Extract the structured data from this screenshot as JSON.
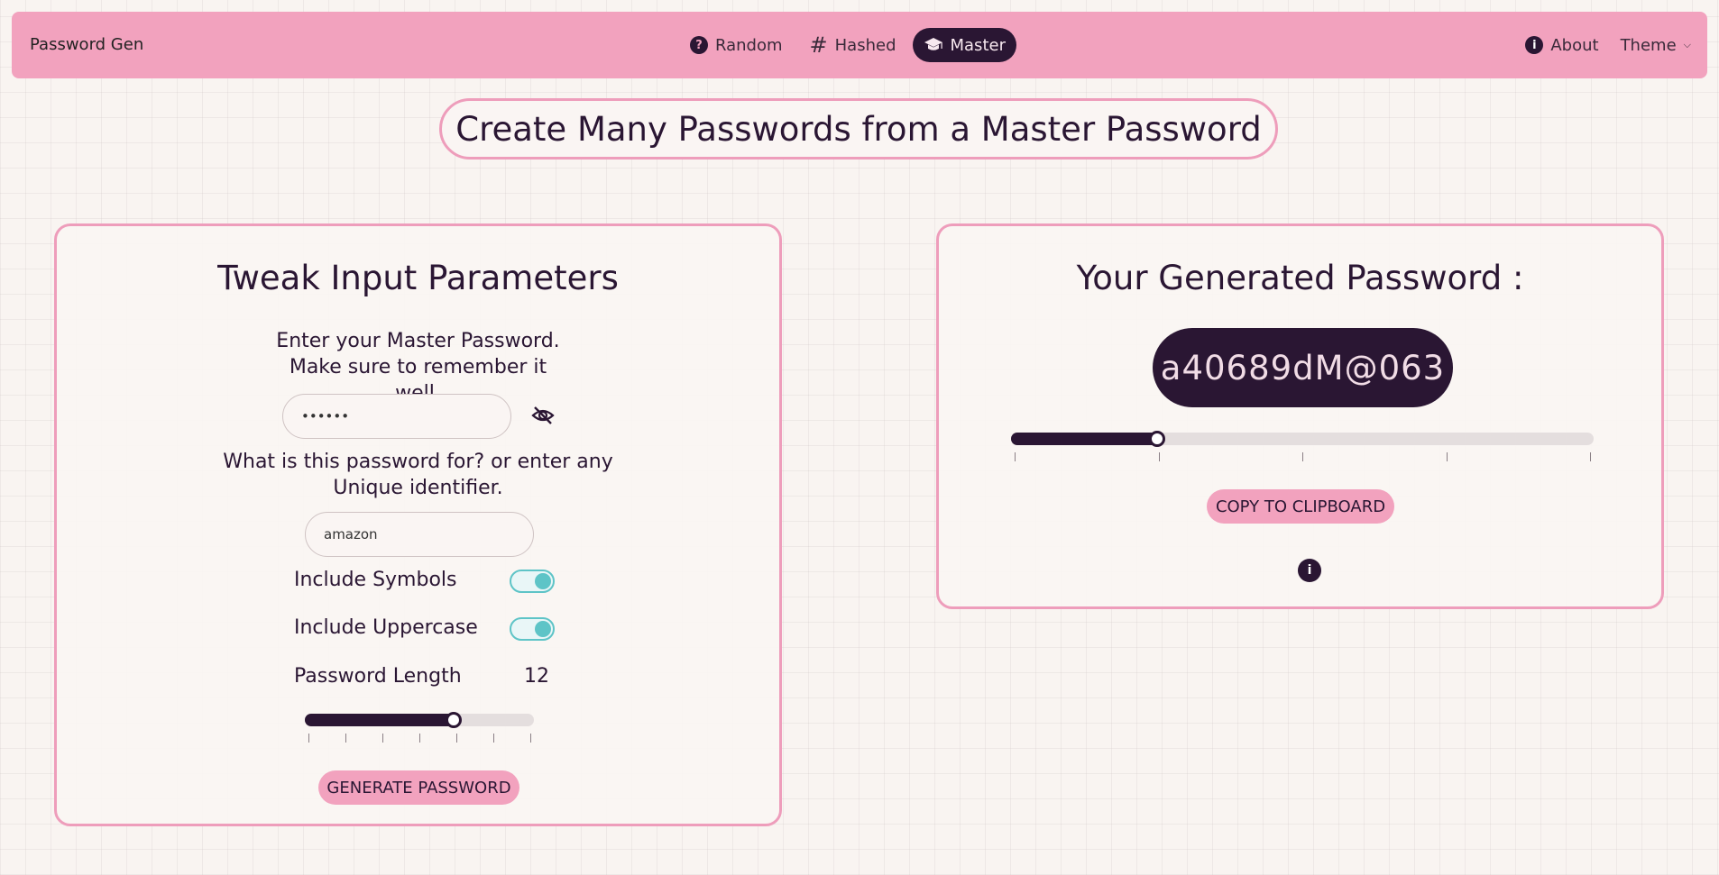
{
  "nav": {
    "brand": "Password Gen",
    "items": [
      {
        "label": "Random",
        "icon": "question-circle-icon",
        "active": false
      },
      {
        "label": "Hashed",
        "icon": "hash-icon",
        "active": false
      },
      {
        "label": "Master",
        "icon": "graduation-cap-icon",
        "active": true
      }
    ],
    "about": "About",
    "theme": "Theme"
  },
  "page_title": "Create Many Passwords from a Master Password",
  "input_card": {
    "title": "Tweak Input Parameters",
    "master_prompt": "Enter your Master Password. Make sure to remember it well.",
    "master_value": "••••••",
    "identifier_prompt": "What is this password for? or enter any Unique identifier.",
    "identifier_value": "amazon",
    "include_symbols_label": "Include Symbols",
    "include_symbols": true,
    "include_uppercase_label": "Include Uppercase",
    "include_uppercase": true,
    "length_label": "Password Length",
    "length_value": "12",
    "length_slider_fraction": 0.65,
    "generate_label": "GENERATE PASSWORD"
  },
  "output_card": {
    "title": "Your Generated Password :",
    "password": "a40689dM@063",
    "strength_slider_fraction": 0.25,
    "copy_label": "COPY TO CLIPBOARD"
  },
  "colors": {
    "accent_pink": "#f2a2be",
    "dark_plum": "#2a1633",
    "toggle_teal": "#5ec4c7",
    "background": "#f9f4f1"
  }
}
